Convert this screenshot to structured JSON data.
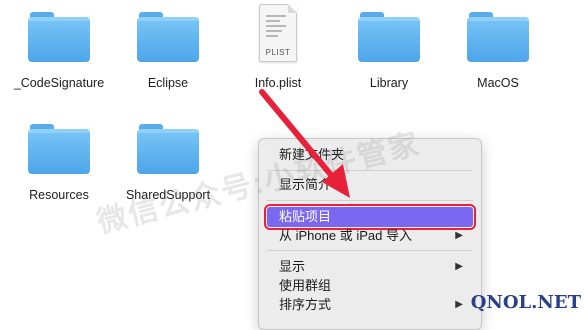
{
  "icons": [
    {
      "label": "_CodeSignature",
      "icon": "folder-icon"
    },
    {
      "label": "Eclipse",
      "icon": "folder-icon"
    },
    {
      "label": "Info.plist",
      "icon": "plist-file-icon",
      "tag": "PLIST"
    },
    {
      "label": "Library",
      "icon": "folder-icon"
    },
    {
      "label": "MacOS",
      "icon": "folder-icon"
    },
    {
      "label": "Resources",
      "icon": "folder-icon"
    },
    {
      "label": "SharedSupport",
      "icon": "folder-icon"
    }
  ],
  "menu": {
    "items": [
      {
        "label": "新建文件夹"
      },
      {
        "label": "显示简介"
      },
      {
        "label": "粘贴项目",
        "highlighted": true
      },
      {
        "label": "从 iPhone 或 iPad 导入",
        "has_submenu": true
      },
      {
        "label": "显示",
        "has_submenu": true
      },
      {
        "label": "使用群组"
      },
      {
        "label": "排序方式",
        "has_submenu": true
      }
    ]
  },
  "colors": {
    "folder": "#5aabec",
    "highlight": "#7b67f0",
    "annotation": "#e8213a"
  },
  "watermark": "微信公众号:小软件管家",
  "corner_brand": "QNOL.NET"
}
